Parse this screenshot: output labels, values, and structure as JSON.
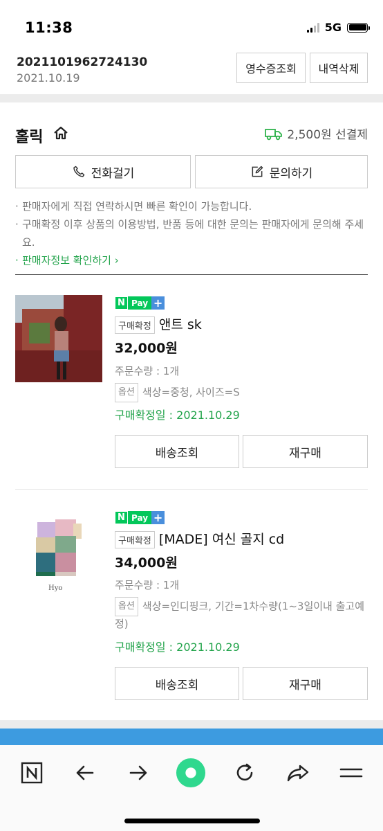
{
  "status": {
    "time": "11:38",
    "network": "5G"
  },
  "order": {
    "number": "2021101962724130",
    "date": "2021.10.19",
    "receipt_button": "영수증조회",
    "delete_button": "내역삭제"
  },
  "shop": {
    "name": "홀릭",
    "shipping": "2,500원 선결제",
    "call_button": "전화걸기",
    "inquiry_button": "문의하기",
    "notes": [
      "판매자에게 직접 연락하시면 빠른 확인이 가능합니다.",
      "구매확정 이후 상품의 이용방법, 반품 등에 대한 문의는 판매자에게 문의해 주세요."
    ],
    "seller_info_link": "판매자정보 확인하기"
  },
  "items": [
    {
      "npay": {
        "n": "N",
        "pay": "Pay",
        "plus": "+"
      },
      "status_badge": "구매확정",
      "name": "앤트 sk",
      "price": "32,000원",
      "quantity": "주문수량 : 1개",
      "option_badge": "옵션",
      "option": "색상=중청, 사이즈=S",
      "confirm_date": "구매확정일 : 2021.10.29",
      "track_button": "배송조회",
      "rebuy_button": "재구매"
    },
    {
      "npay": {
        "n": "N",
        "pay": "Pay",
        "plus": "+"
      },
      "status_badge": "구매확정",
      "name": "[MADE] 여신 골지 cd",
      "price": "34,000원",
      "quantity": "주문수량 : 1개",
      "option_badge": "옵션",
      "option": "색상=인디핑크, 기간=1차수량(1~3일이내 출고예정)",
      "confirm_date": "구매확정일 : 2021.10.29",
      "track_button": "배송조회",
      "rebuy_button": "재구매"
    }
  ],
  "bottom_nav": [
    "n-logo-icon",
    "back-arrow-icon",
    "forward-arrow-icon",
    "green-dot-icon",
    "refresh-icon",
    "share-icon",
    "menu-icon"
  ],
  "colors": {
    "green": "#21a34a",
    "npay_green": "#03c75a",
    "blue_band": "#3d9be0"
  }
}
